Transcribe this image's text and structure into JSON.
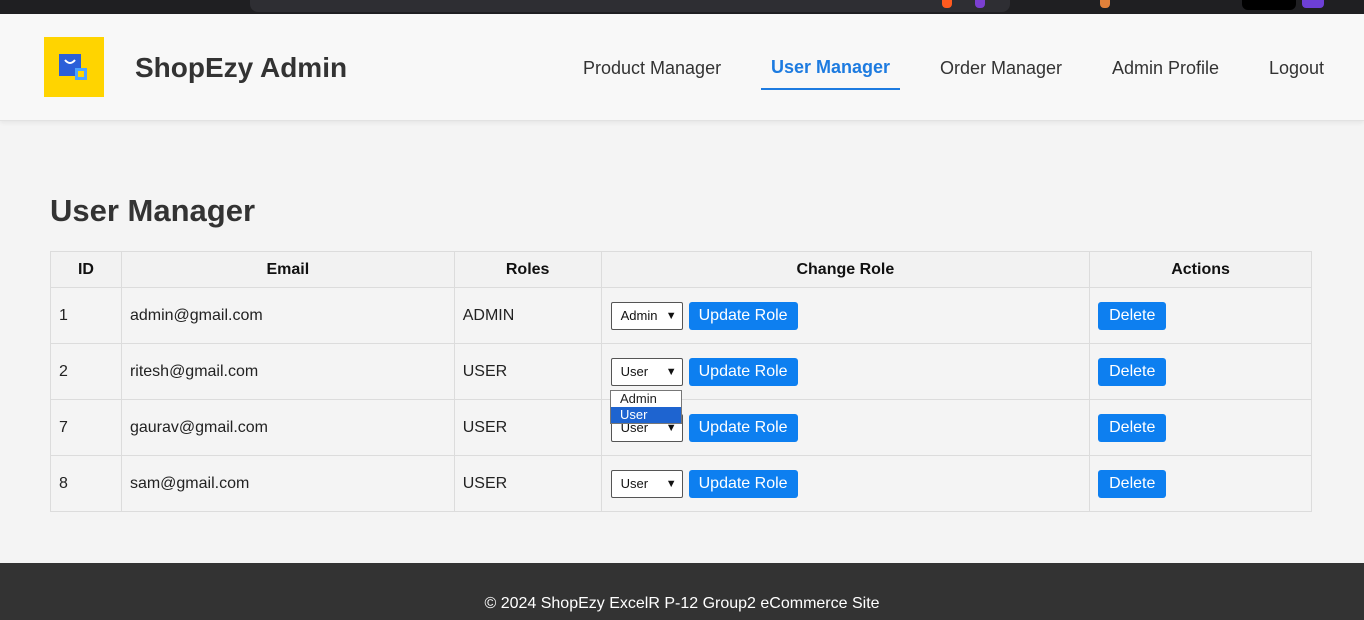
{
  "header": {
    "brand": "ShopEzy Admin",
    "nav": [
      {
        "label": "Product Manager",
        "active": false
      },
      {
        "label": "User Manager",
        "active": true
      },
      {
        "label": "Order Manager",
        "active": false
      },
      {
        "label": "Admin Profile",
        "active": false
      },
      {
        "label": "Logout",
        "active": false
      }
    ]
  },
  "main": {
    "title": "User Manager",
    "columns": [
      "ID",
      "Email",
      "Roles",
      "Change Role",
      "Actions"
    ],
    "rows": [
      {
        "id": "1",
        "email": "admin@gmail.com",
        "role": "ADMIN",
        "select_value": "Admin"
      },
      {
        "id": "2",
        "email": "ritesh@gmail.com",
        "role": "USER",
        "select_value": "User"
      },
      {
        "id": "7",
        "email": "gaurav@gmail.com",
        "role": "USER",
        "select_value": "User"
      },
      {
        "id": "8",
        "email": "sam@gmail.com",
        "role": "USER",
        "select_value": "User"
      }
    ],
    "update_label": "Update Role",
    "delete_label": "Delete",
    "dropdown_open": {
      "row": 2,
      "options": [
        "Admin",
        "User"
      ],
      "selected": "User"
    }
  },
  "footer": {
    "text": "© 2024 ShopEzy ExcelR P-12 Group2 eCommerce Site"
  },
  "colors": {
    "accent": "#1d7be0",
    "button": "#0d7ff0",
    "logo_bg": "#ffd400",
    "footer_bg": "#333333"
  }
}
